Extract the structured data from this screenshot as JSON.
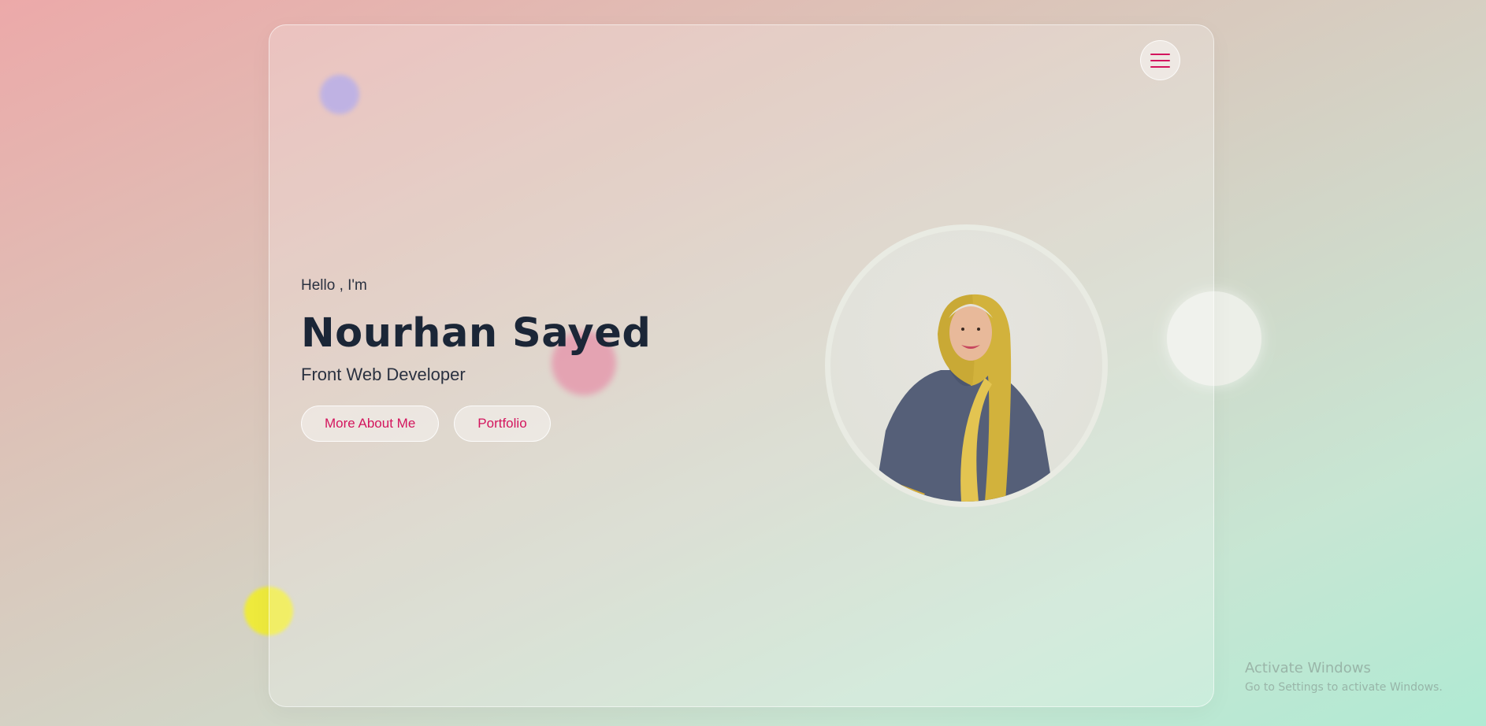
{
  "page": {
    "accent_color": "#d3155d",
    "text_color": "#1b2637"
  },
  "nav": {
    "menu_icon": "hamburger-menu-icon"
  },
  "hero": {
    "greeting": "Hello , I'm",
    "name": "Nourhan Sayed",
    "role": "Front Web Developer",
    "buttons": [
      {
        "label": "More About Me"
      },
      {
        "label": "Portfolio"
      }
    ]
  },
  "watermark": {
    "title": "Activate Windows",
    "subtitle": "Go to Settings to activate Windows."
  }
}
